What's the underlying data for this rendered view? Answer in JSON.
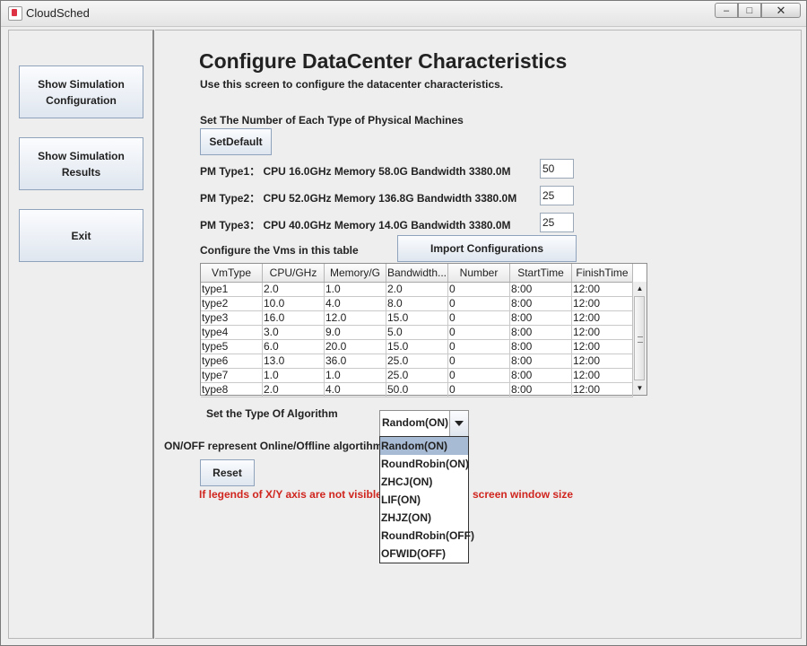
{
  "window": {
    "title": "CloudSched",
    "min_glyph": "–",
    "max_glyph": "□",
    "close_glyph": "✕"
  },
  "sidebar": {
    "buttons": [
      {
        "line1": "Show Simulation",
        "line2": "Configuration"
      },
      {
        "line1": "Show Simulation",
        "line2": "Results"
      },
      {
        "line1": "Exit",
        "line2": ""
      }
    ]
  },
  "main": {
    "title": "Configure DataCenter Characteristics",
    "subtitle": "Use this screen to configure the datacenter characteristics.",
    "pm_section_label": "Set The Number of Each Type of Physical Machines",
    "set_default_label": "SetDefault",
    "pm_types": [
      {
        "label": "PM Type1： CPU 16.0GHz Memory 58.0G Bandwidth 3380.0M",
        "value": "50"
      },
      {
        "label": "PM Type2： CPU 52.0GHz Memory 136.8G Bandwidth 3380.0M",
        "value": "25"
      },
      {
        "label": "PM Type3： CPU 40.0GHz Memory 14.0G Bandwidth 3380.0M",
        "value": "25"
      }
    ],
    "vm_label": "Configure the Vms in this table",
    "import_label": "Import Configurations",
    "vm_table": {
      "columns": [
        "VmType",
        "CPU/GHz",
        "Memory/G",
        "Bandwidth...",
        "Number",
        "StartTime",
        "FinishTime"
      ],
      "rows": [
        [
          "type1",
          "2.0",
          "1.0",
          "2.0",
          "0",
          "8:00",
          "12:00"
        ],
        [
          "type2",
          "10.0",
          "4.0",
          "8.0",
          "0",
          "8:00",
          "12:00"
        ],
        [
          "type3",
          "16.0",
          "12.0",
          "15.0",
          "0",
          "8:00",
          "12:00"
        ],
        [
          "type4",
          "3.0",
          "9.0",
          "5.0",
          "0",
          "8:00",
          "12:00"
        ],
        [
          "type5",
          "6.0",
          "20.0",
          "15.0",
          "0",
          "8:00",
          "12:00"
        ],
        [
          "type6",
          "13.0",
          "36.0",
          "25.0",
          "0",
          "8:00",
          "12:00"
        ],
        [
          "type7",
          "1.0",
          "1.0",
          "25.0",
          "0",
          "8:00",
          "12:00"
        ],
        [
          "type8",
          "2.0",
          "4.0",
          "50.0",
          "0",
          "8:00",
          "12:00"
        ]
      ]
    },
    "algo_label": "Set the Type Of Algorithm",
    "algo_selected": "Random(ON)",
    "algo_options": [
      "Random(ON)",
      "RoundRobin(ON)",
      "ZHCJ(ON)",
      "LIF(ON)",
      "ZHJZ(ON)",
      "RoundRobin(OFF)",
      "OFWID(OFF)"
    ],
    "onoff_note": "ON/OFF represent Online/Offline algortihm",
    "reset_label": "Reset",
    "warning_left": "If legends of X/Y axis are not visible",
    "warning_right": "screen window size"
  },
  "colors": {
    "warning": "#d0251e",
    "selection": "#a8bbd4"
  }
}
